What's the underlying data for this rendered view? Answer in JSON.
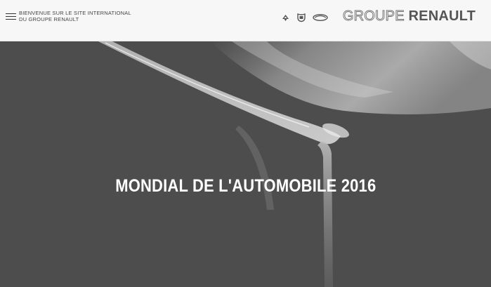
{
  "header": {
    "welcome_line1": "BIENVENUE SUR LE SITE INTERNATIONAL",
    "welcome_line2": "DU GROUPE RENAULT",
    "brand_icons": [
      "alpine-icon",
      "dacia-icon",
      "renault-samsung-icon"
    ],
    "logo_part1": "GROUPE",
    "logo_part2": "RENAULT"
  },
  "hero": {
    "title": "MONDIAL DE L'AUTOMOBILE 2016",
    "background_color": "#4d4d4d"
  },
  "colors": {
    "header_bg": "#f7f7f7",
    "logo_text": "#555555",
    "hero_text": "#ffffff"
  }
}
